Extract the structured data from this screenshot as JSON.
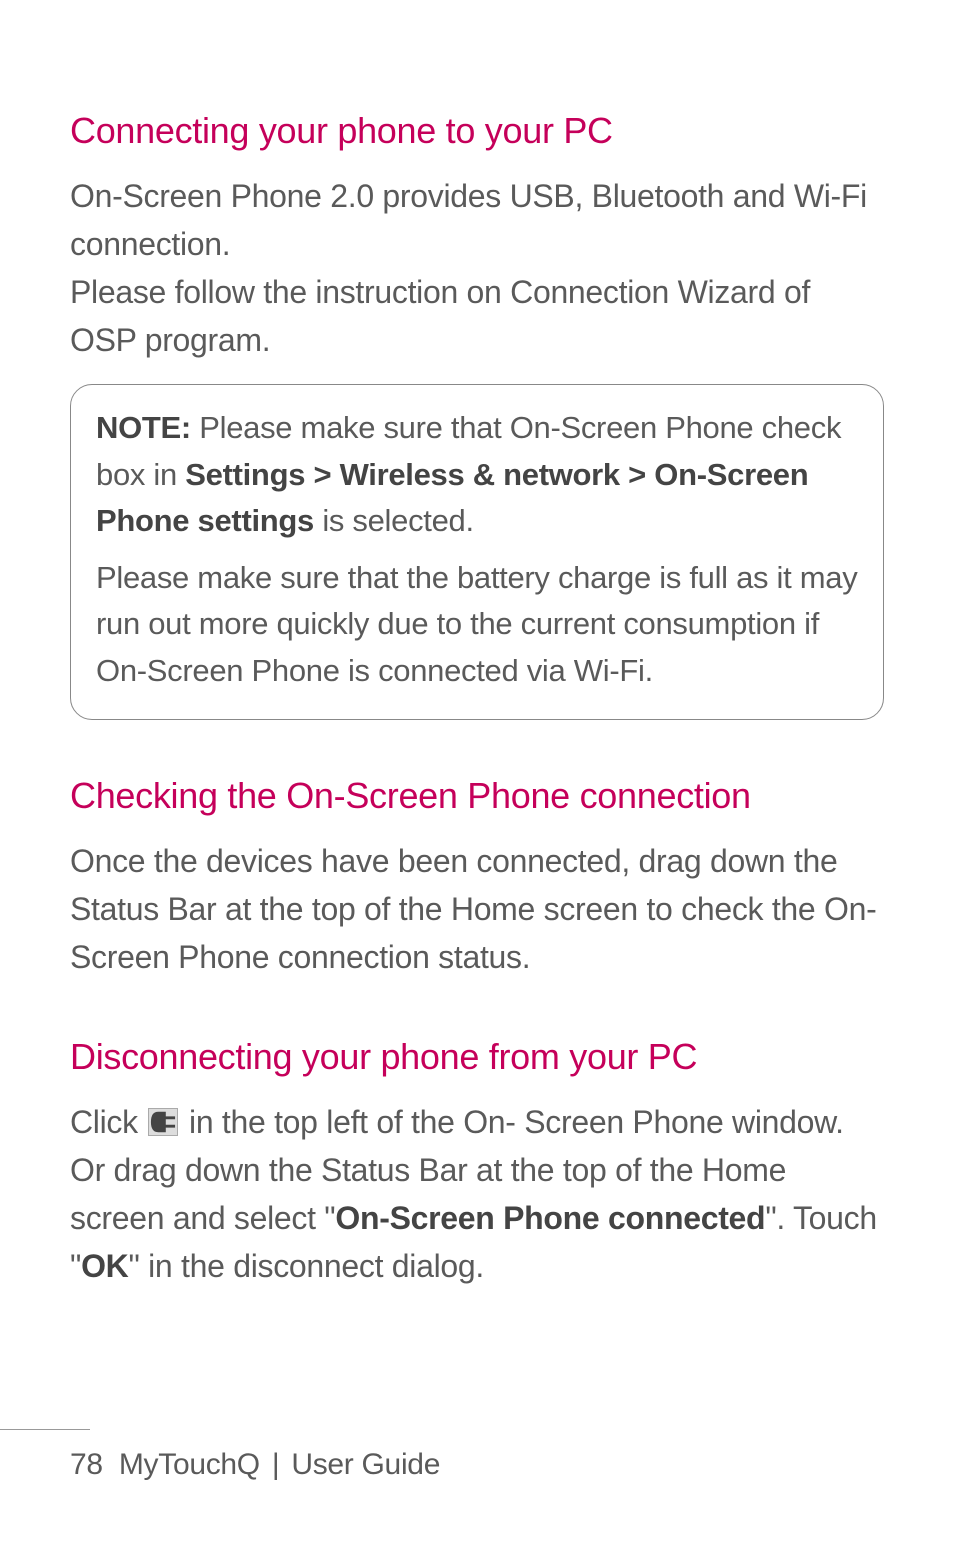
{
  "section1": {
    "heading": "Connecting your phone to your PC",
    "p1": "On-Screen Phone 2.0 provides USB, Bluetooth and Wi-Fi connection.",
    "p2": "Please follow the instruction on Connection Wizard of OSP program."
  },
  "note": {
    "label": "NOTE:",
    "p1_pre": " Please make sure that On-Screen Phone check box in ",
    "p1_bold": "Settings > Wireless & network > On-Screen Phone settings",
    "p1_post": " is selected.",
    "p2": "Please make sure that the battery charge is full as it may run out more quickly due to the current consumption if On-Screen Phone is connected via Wi-Fi."
  },
  "section2": {
    "heading": "Checking the On-Screen Phone connection",
    "p1": "Once the devices have been connected, drag down the Status Bar at the top of the Home screen to check the On-Screen Phone connection status."
  },
  "section3": {
    "heading": "Disconnecting your phone from your PC",
    "p1_pre": "Click ",
    "p1_mid": " in the top left of the On- Screen Phone window. Or drag down the Status Bar at the top of the Home screen and select \"",
    "p1_bold1": "On-Screen Phone connected",
    "p1_mid2": "\". Touch \"",
    "p1_bold2": "OK",
    "p1_post": "\" in the disconnect dialog."
  },
  "footer": {
    "page_number": "78",
    "product": "MyTouchQ",
    "sep": "|",
    "doc": "User Guide"
  }
}
